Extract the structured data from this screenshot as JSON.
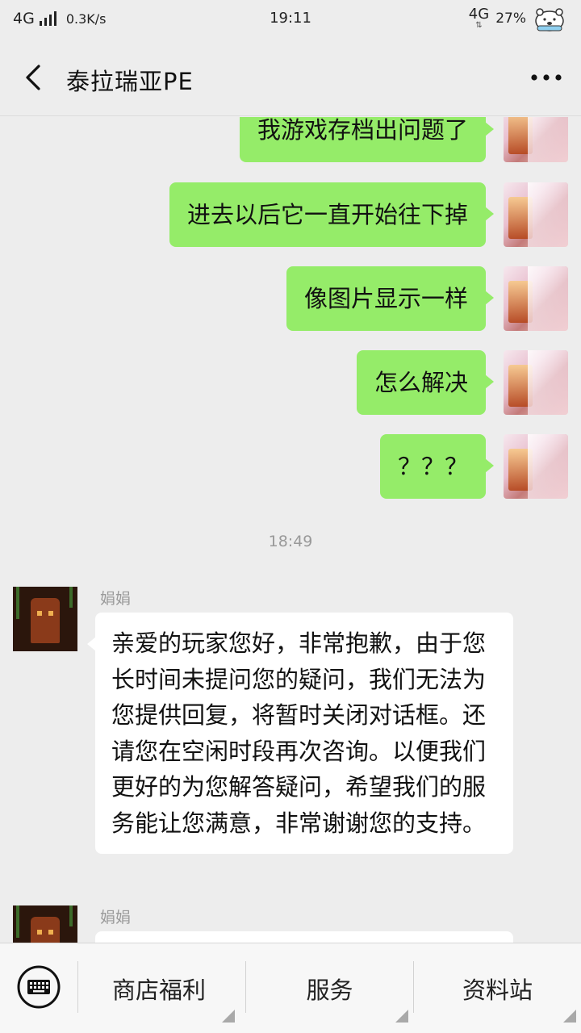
{
  "status_bar": {
    "network": "4G",
    "speed": "0.3K/s",
    "time": "19:11",
    "network_right": "4G",
    "battery": "27%"
  },
  "nav": {
    "title": "泰拉瑞亚PE",
    "back_icon": "chevron-left-icon",
    "more_icon": "more-dots-icon"
  },
  "messages_sent": [
    "我游戏存档出问题了",
    "进去以后它一直开始往下掉",
    "像图片显示一样",
    "怎么解决",
    "？？？"
  ],
  "timestamp": "18:49",
  "received": [
    {
      "sender": "娟娟",
      "text": "亲爱的玩家您好，非常抱歉，由于您长时间未提问您的疑问，我们无法为您提供回复，将暂时关闭对话框。还请您在空闲时段再次咨询。以便我们更好的为您解答疑问，希望我们的服务能让您满意，非常谢谢您的支持。"
    },
    {
      "sender": "娟娟",
      "text": ""
    }
  ],
  "bottom_menu": {
    "keyboard_icon": "keyboard-icon",
    "items": [
      "商店福利",
      "服务",
      "资料站"
    ]
  },
  "colors": {
    "sent_bubble": "#95ec69",
    "received_bubble": "#ffffff",
    "background": "#ededed"
  }
}
